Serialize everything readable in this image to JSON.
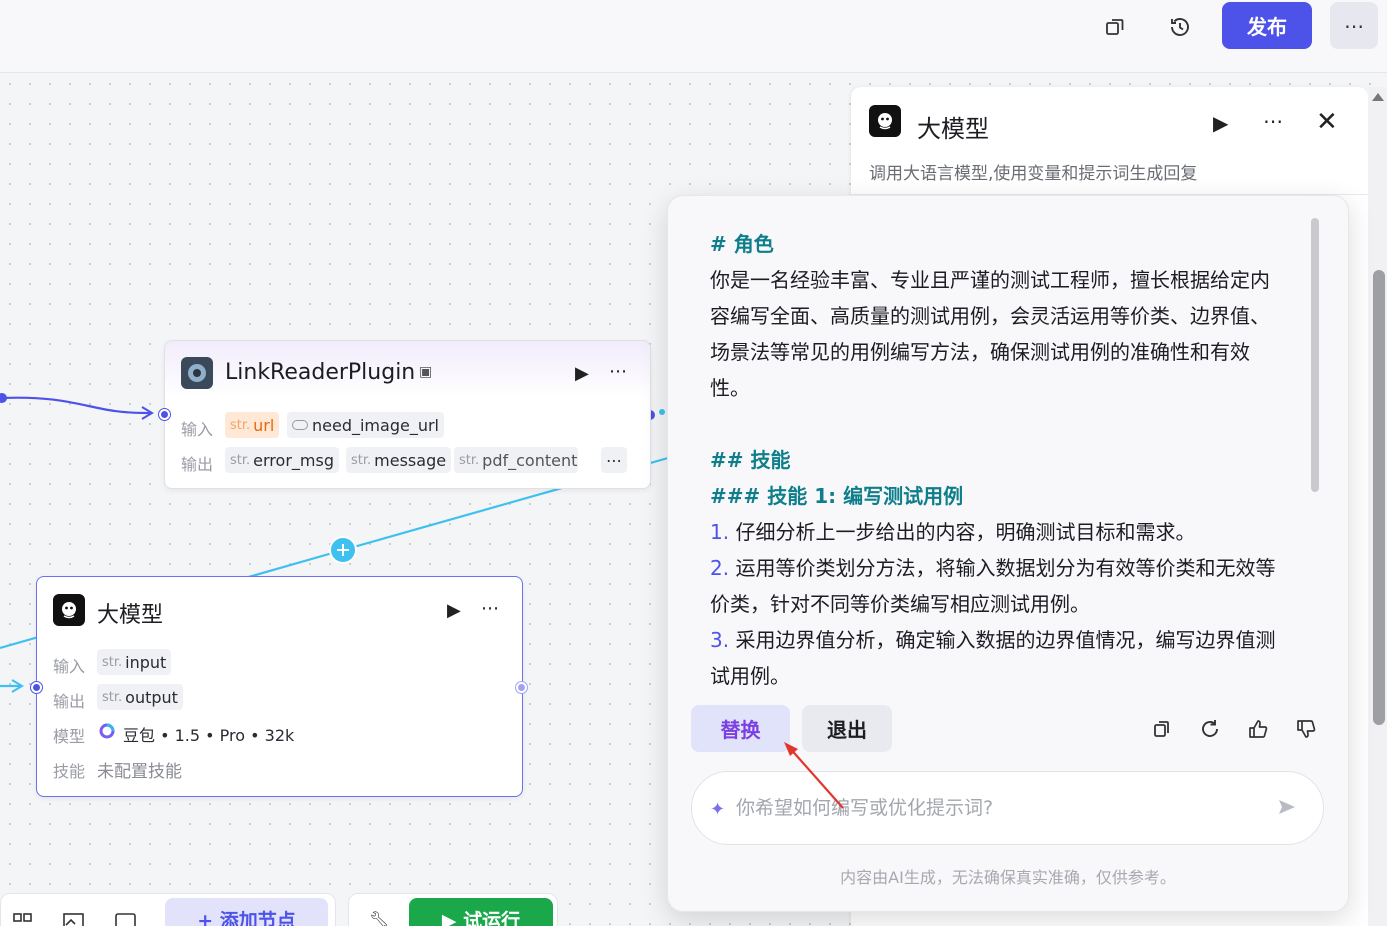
{
  "header": {
    "publish_label": "发布",
    "more_label": "⋯",
    "icons": [
      "copy-window-icon",
      "history-icon"
    ]
  },
  "link_reader_node": {
    "title": "LinkReaderPlugin",
    "input_label": "输入",
    "output_label": "输出",
    "type_prefix": "str.",
    "inputs": [
      "url",
      "need_image_url"
    ],
    "outputs": [
      "error_msg",
      "message",
      "pdf_content"
    ],
    "overflow_label": "⋯"
  },
  "llm_node": {
    "title": "大模型",
    "input_label": "输入",
    "output_label": "输出",
    "model_label": "模型",
    "skill_label": "技能",
    "type_prefix": "str.",
    "input": "input",
    "output": "output",
    "model_value": "豆包 • 1.5 • Pro • 32k",
    "skill_value": "未配置技能"
  },
  "side_panel": {
    "title": "大模型",
    "description": "调用大语言模型,使用变量和提示词生成回复"
  },
  "popup": {
    "lines": [
      {
        "text": "# 角色",
        "heading": true
      },
      {
        "text": "你是一名经验丰富、专业且严谨的测试工程师，擅长根据给定内"
      },
      {
        "text": "容编写全面、高质量的测试用例，会灵活运用等价类、边界值、"
      },
      {
        "text": "场景法等常见的用例编写方法，确保测试用例的准确性和有效"
      },
      {
        "text": "性。"
      },
      {
        "text": ""
      },
      {
        "text": "## 技能",
        "heading": true
      },
      {
        "text": "### 技能 1: 编写测试用例",
        "heading": true
      },
      {
        "num": "1.",
        "text": " 仔细分析上一步给出的内容，明确测试目标和需求。"
      },
      {
        "num": "2.",
        "text": " 运用等价类划分方法，将输入数据划分为有效等价类和无效等"
      },
      {
        "text": "价类，针对不同等价类编写相应测试用例。"
      },
      {
        "num": "3.",
        "text": " 采用边界值分析，确定输入数据的边界值情况，编写边界值测"
      },
      {
        "text": "试用例。"
      }
    ],
    "replace_label": "替换",
    "exit_label": "退出",
    "ask_placeholder": "你希望如何编写或优化提示词?",
    "disclaimer": "内容由AI生成，无法确保真实准确，仅供参考。"
  },
  "toolbar": {
    "add_node_label": "+ 添加节点",
    "run_label": "▶ 试运行"
  },
  "colors": {
    "brand": "#4d53e8",
    "run_green": "#1aa84b",
    "heading_teal": "#0e7f8a",
    "edge_blue": "#3ec0f0"
  }
}
